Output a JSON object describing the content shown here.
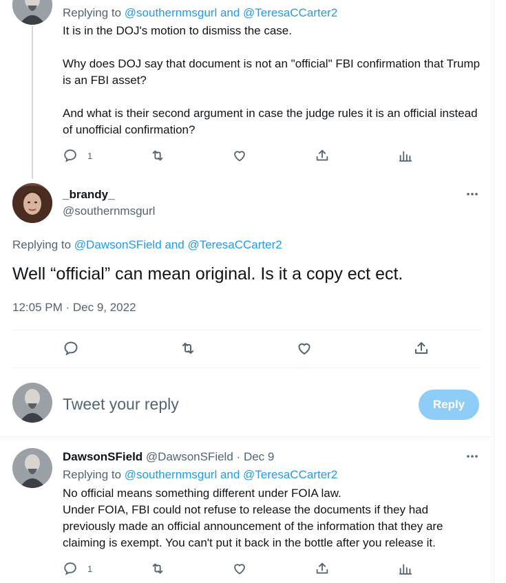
{
  "tweet_prev": {
    "replying_prefix": "Replying to",
    "replying_users": "@southernmsgurl and @TeresaCCarter2",
    "paragraphs": [
      "It is in the DOJ's motion to dismiss the case.",
      "Why does DOJ say that document is not an \"official\" FBI confirmation that Trump is an FBI asset?",
      "And what is their second argument in case the judge rules it is an official instead of unofficial confirmation?"
    ],
    "reply_count": "1"
  },
  "main_tweet": {
    "display_name": "_brandy_",
    "handle": "@southernmsgurl",
    "more_icon": "more-dots-icon",
    "replying_prefix": "Replying to",
    "replying_users": "@DawsonSField and @TeresaCCarter2",
    "text": "Well “official” can mean original. Is it a copy ect ect.",
    "timestamp": "12:05 PM · Dec 9, 2022"
  },
  "composer": {
    "placeholder": "Tweet your reply",
    "reply_label": "Reply"
  },
  "tweet_next": {
    "display_name": "DawsonSField",
    "handle": "@DawsonSField",
    "sep": "·",
    "date": "Dec 9",
    "replying_prefix": "Replying to",
    "replying_users": "@southernmsgurl and @TeresaCCarter2",
    "lines": [
      "No official means something different under FOIA law.",
      "Under FOIA, FBI could not refuse to release the documents if they had previously made an official announcement of the information that they are claiming is exempt. You can't put it back in the bottle after you release it."
    ],
    "reply_count": "1"
  },
  "colors": {
    "link": "#1d9bf0",
    "muted": "#536471",
    "reply_button": "#8ecdf8",
    "divider": "#eff3f4"
  }
}
